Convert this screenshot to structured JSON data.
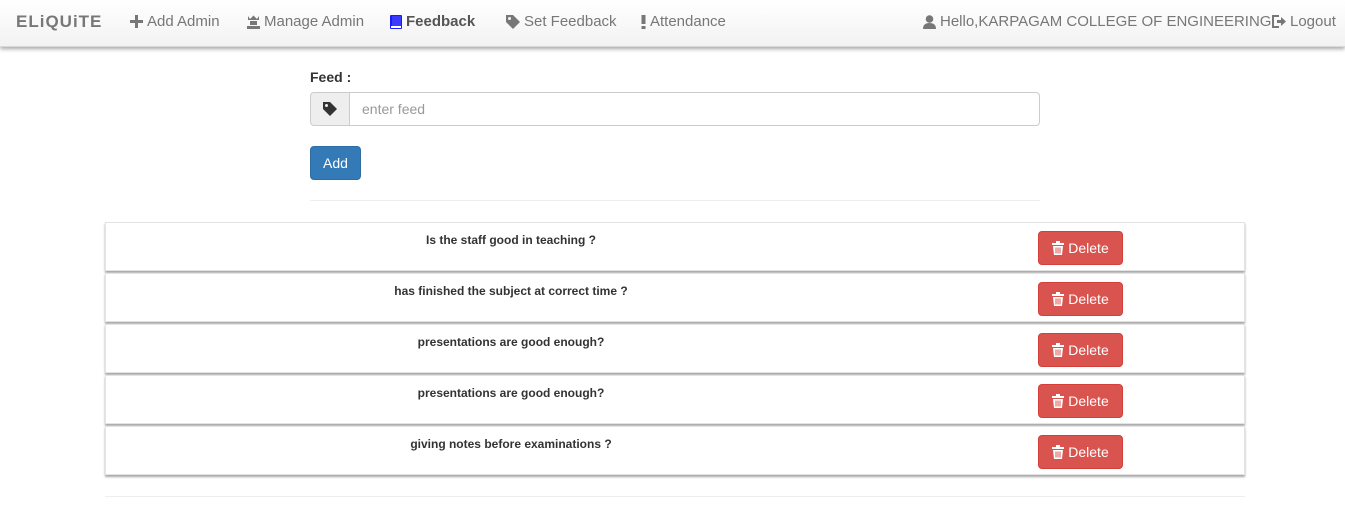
{
  "navbar": {
    "brand": "ELiQUiTE",
    "items": [
      {
        "label": "Add Admin",
        "icon": "plus-icon"
      },
      {
        "label": "Manage Admin",
        "icon": "user-crown-icon"
      },
      {
        "label": "Feedback",
        "icon": "book-icon",
        "active": true
      },
      {
        "label": "Set Feedback",
        "icon": "tag-icon"
      },
      {
        "label": "Attendance",
        "icon": "exclamation-icon"
      }
    ],
    "greeting": "Hello,KARPAGAM COLLEGE OF ENGINEERING",
    "logout": "Logout"
  },
  "form": {
    "label": "Feed :",
    "placeholder": "enter feed",
    "value": "",
    "add_label": "Add"
  },
  "feedback": {
    "delete_label": "Delete",
    "items": [
      "Is the staff good in teaching ?",
      "has finished the subject at correct time ?",
      "presentations are good enough?",
      "presentations are good enough?",
      "giving notes before examinations ?"
    ]
  },
  "colors": {
    "primary": "#337ab7",
    "danger": "#d9534f",
    "active_icon": "#1a1aff"
  }
}
